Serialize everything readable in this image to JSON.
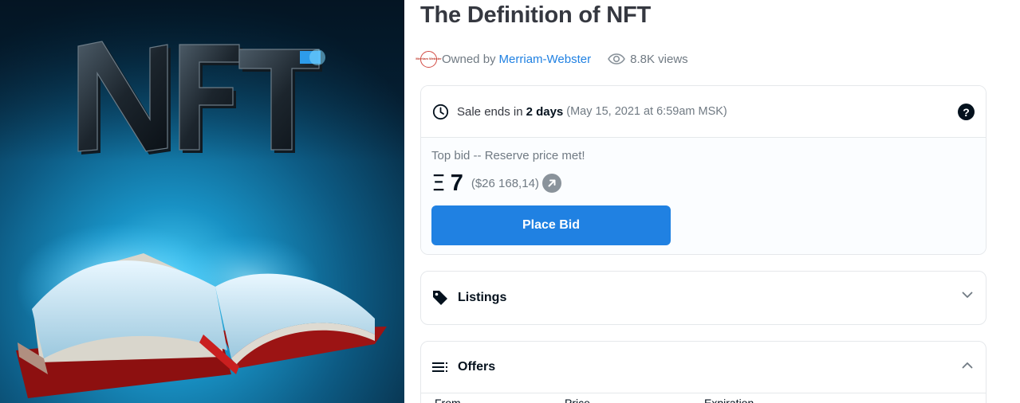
{
  "artwork": {
    "logo_text": "NFT"
  },
  "asset": {
    "title": "The Definition of NFT",
    "owned_by_label": "Owned by",
    "owner": "Merriam-Webster",
    "avatar_text": "Merriam Webster",
    "views": "8.8K views"
  },
  "sale": {
    "ends_prefix": "Sale ends in",
    "ends_bold": "2 days",
    "ends_date": "(May 15, 2021 at 6:59am MSK)",
    "help_glyph": "?",
    "top_bid_label": "Top bid -- Reserve price met!",
    "currency_symbol": "Ξ",
    "price": "7",
    "usd_price": "($26 168,14)",
    "place_bid_label": "Place Bid"
  },
  "listings": {
    "label": "Listings",
    "state": "collapsed"
  },
  "offers": {
    "label": "Offers",
    "state": "expanded",
    "columns": [
      "From",
      "Price",
      "Expiration"
    ]
  },
  "colors": {
    "accent": "#2081e2",
    "text_dark": "#04111d",
    "text_muted": "#707a83",
    "border": "#e5e8eb"
  },
  "icons": [
    "clock-icon",
    "help-icon",
    "external-link-icon",
    "tag-icon",
    "list-icon",
    "chevron-down-icon",
    "chevron-up-icon",
    "eye-icon"
  ]
}
